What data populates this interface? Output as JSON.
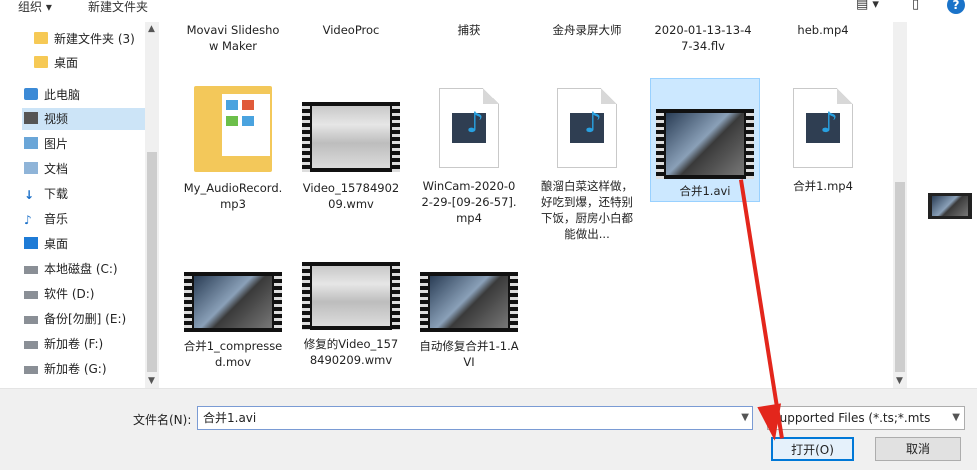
{
  "toolbar": {
    "organize": "组织 ▾",
    "new_folder": "新建文件夹"
  },
  "sidebar": {
    "items": [
      {
        "label": "新建文件夹 (3)"
      },
      {
        "label": "桌面"
      },
      {
        "label": "此电脑"
      },
      {
        "label": "视频"
      },
      {
        "label": "图片"
      },
      {
        "label": "文档"
      },
      {
        "label": "下载"
      },
      {
        "label": "音乐"
      },
      {
        "label": "桌面"
      },
      {
        "label": "本地磁盘 (C:)"
      },
      {
        "label": "软件 (D:)"
      },
      {
        "label": "备份[勿删] (E:)"
      },
      {
        "label": "新加卷 (F:)"
      },
      {
        "label": "新加卷 (G:)"
      }
    ]
  },
  "files": {
    "row0": [
      {
        "label": "Movavi Slideshow Maker"
      },
      {
        "label": "VideoProc"
      },
      {
        "label": "捕获"
      },
      {
        "label": "金舟录屏大师"
      },
      {
        "label": "2020-01-13-13-47-34.flv"
      },
      {
        "label": "heb.mp4"
      }
    ],
    "row1": [
      {
        "label": "My_AudioRecord.mp3"
      },
      {
        "label": "Video_1578490209.wmv"
      },
      {
        "label": "WinCam-2020-02-29-[09-26-57].mp4"
      },
      {
        "label": "酿溜白菜这样做，好吃到爆，还特别下饭，厨房小白都能做出..."
      },
      {
        "label": "合并1.avi"
      },
      {
        "label": "合并1.mp4"
      }
    ],
    "row2": [
      {
        "label": "合并1_compressed.mov"
      },
      {
        "label": "修复的Video_1578490209.wmv"
      },
      {
        "label": "自动修复合并1-1.AVI"
      }
    ]
  },
  "bottom": {
    "filename_label": "文件名(N):",
    "filename_value": "合并1.avi",
    "filetype": "Supported Files (*.ts;*.mts",
    "open_label": "打开(O)",
    "cancel_label": "取消"
  }
}
